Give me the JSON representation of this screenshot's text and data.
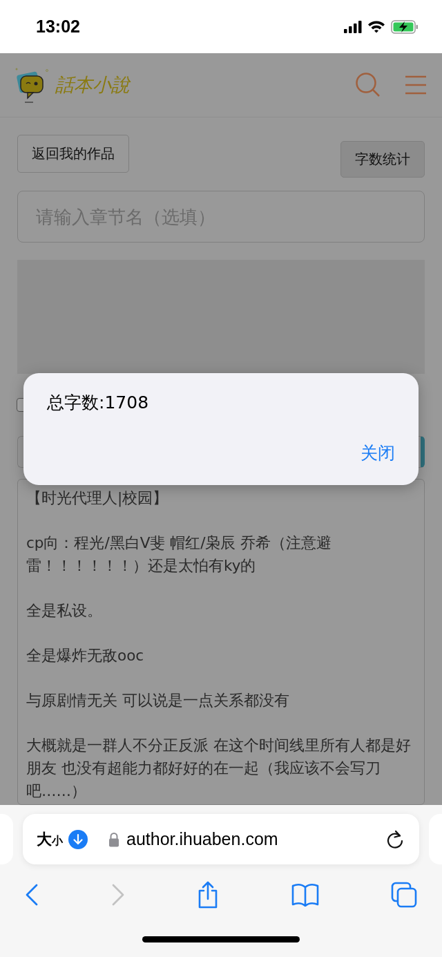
{
  "status_bar": {
    "time": "13:02"
  },
  "header": {
    "logo_text": "話本小說"
  },
  "toolbar": {
    "back_button": "返回我的作品",
    "count_button": "字数统计"
  },
  "chapter_field": {
    "placeholder": "请输入章节名（选填）"
  },
  "option_checkbox": {
    "checked": false
  },
  "content": {
    "paragraphs": [
      "【时光代理人|校园】",
      "cp向：程光/黑白V斐 帽红/枭辰 乔希（注意避雷！！！！！！）还是太怕有ky的",
      "全是私设。",
      "全是爆炸无敌ooc",
      "与原剧情无关 可以说是一点关系都没有",
      "大概就是一群人不分正反派 在这个时间线里所有人都是好朋友 也没有超能力都好好的在一起（我应该不会写刀吧……）"
    ]
  },
  "dialog": {
    "message": "总字数:1708",
    "close_button": "关闭"
  },
  "browser": {
    "text_size_large": "大",
    "text_size_small": "小",
    "url": "author.ihuaben.com",
    "nav": [
      {
        "kind": "back",
        "disabled": false
      },
      {
        "kind": "forward",
        "disabled": true
      },
      {
        "kind": "share",
        "disabled": false
      },
      {
        "kind": "bookmarks",
        "disabled": false
      },
      {
        "kind": "tabs",
        "disabled": false
      }
    ]
  }
}
